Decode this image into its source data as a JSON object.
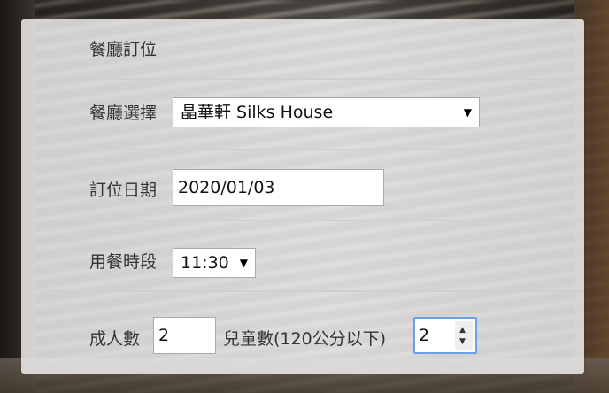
{
  "panel": {
    "title": "餐廳訂位"
  },
  "restaurant": {
    "label": "餐廳選擇",
    "selected": "晶華軒 Silks House"
  },
  "date": {
    "label": "訂位日期",
    "value": "2020/01/03"
  },
  "time": {
    "label": "用餐時段",
    "selected": "11:30"
  },
  "party": {
    "adults_label": "成人數",
    "adults_value": "2",
    "children_label": "兒童數(120公分以下)",
    "children_value": "2"
  },
  "icons": {
    "dropdown": "▼",
    "spin_up": "▲",
    "spin_down": "▼"
  }
}
